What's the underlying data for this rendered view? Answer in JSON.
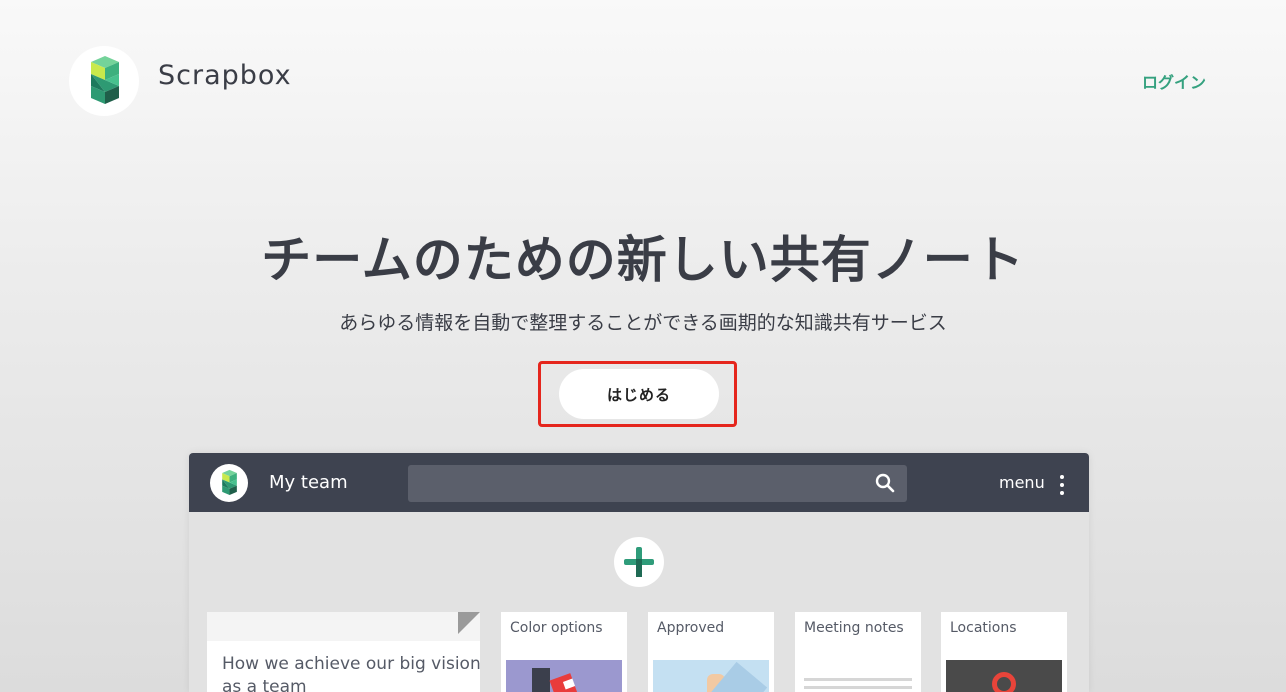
{
  "header": {
    "brand": "Scrapbox",
    "login": "ログイン"
  },
  "hero": {
    "title": "チームのための新しい共有ノート",
    "subtitle": "あらゆる情報を自動で整理することができる画期的な知識共有サービス",
    "cta": "はじめる"
  },
  "app": {
    "team_name": "My team",
    "menu_label": "menu",
    "cards": {
      "featured_text": "How we achieve our big vision as a team",
      "items": [
        {
          "title": "Color options"
        },
        {
          "title": "Approved"
        },
        {
          "title": "Meeting notes"
        },
        {
          "title": "Locations"
        }
      ]
    }
  },
  "icons": {
    "logo": "scrapbox-logo-icon",
    "search": "search-icon",
    "menu": "vertical-dots-icon",
    "add": "plus-icon"
  },
  "colors": {
    "accent": "#35a17f",
    "cta_highlight": "#e5261d",
    "nav_bg": "#3e4350",
    "text_dark": "#3a3d46"
  }
}
